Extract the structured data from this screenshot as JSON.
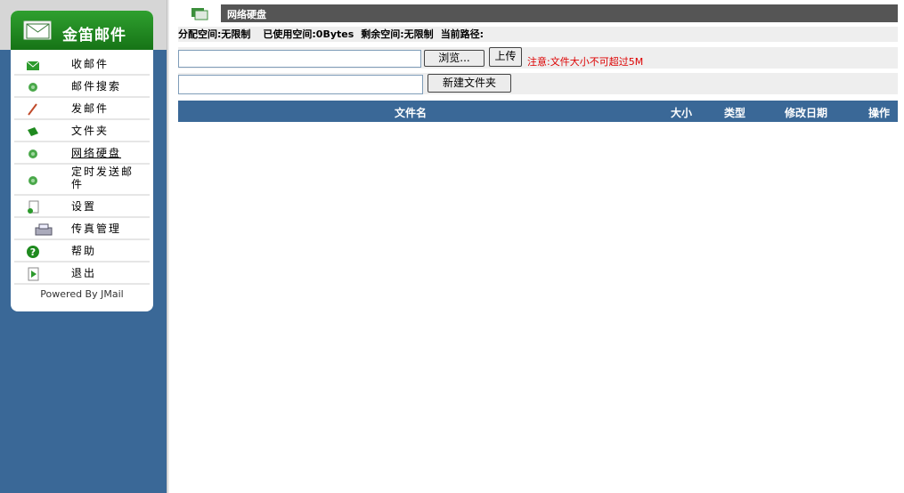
{
  "sidebar": {
    "brand": "金笛邮件",
    "items": [
      {
        "label": "收邮件",
        "icon": "inbox-icon"
      },
      {
        "label": "邮件搜索",
        "icon": "search-icon"
      },
      {
        "label": "发邮件",
        "icon": "compose-icon"
      },
      {
        "label": "文件夹",
        "icon": "folder-icon"
      },
      {
        "label": "网络硬盘",
        "icon": "netdisk-icon"
      },
      {
        "label": "定时发送邮件",
        "icon": "scheduled-send-icon"
      },
      {
        "label": "设置",
        "icon": "settings-icon"
      },
      {
        "label": "传真管理",
        "icon": "fax-icon"
      },
      {
        "label": "帮助",
        "icon": "help-icon"
      },
      {
        "label": "退出",
        "icon": "logout-icon"
      }
    ],
    "powered_by": "Powered By JMail"
  },
  "main": {
    "title": "网络硬盘",
    "quota": {
      "allocated": "分配空间:无限制",
      "used": "已使用空间:0Bytes",
      "remaining": "剩余空间:无限制",
      "current_path": "当前路径:"
    },
    "upload": {
      "file_value": "",
      "browse_label": "浏览...",
      "upload_label": "上传",
      "note": "注意:文件大小不可超过5M"
    },
    "new_folder": {
      "input_value": "",
      "button_label": "新建文件夹"
    },
    "table": {
      "columns": [
        "文件名",
        "大小",
        "类型",
        "修改日期",
        "操作"
      ],
      "rows": []
    }
  },
  "colors": {
    "sidebar_bg": "#3a6897",
    "brand_green": "#1e8a1e",
    "title_bar": "#555555",
    "note_red": "#dd0000",
    "table_header": "#3a6897"
  }
}
